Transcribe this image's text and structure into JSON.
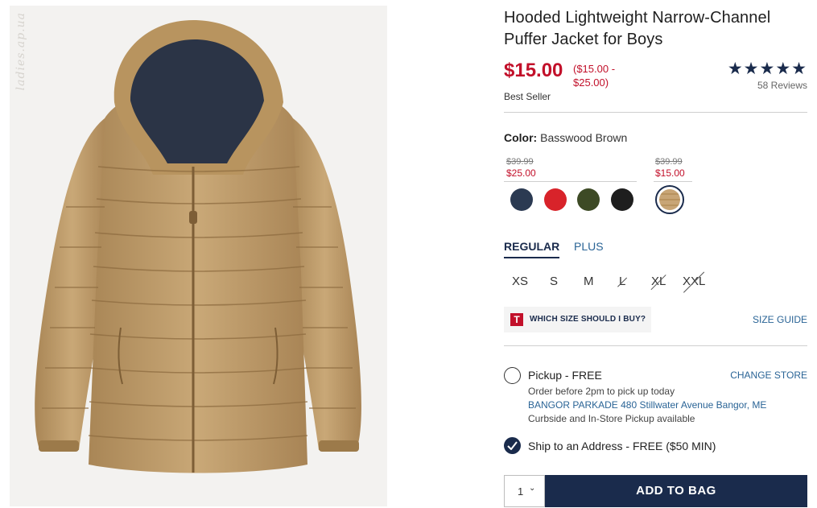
{
  "product": {
    "title": "Hooded Lightweight Narrow-Channel Puffer Jacket for Boys",
    "price": "$15.00",
    "price_range": "($15.00 - $25.00)",
    "badge": "Best Seller",
    "rating": {
      "stars": 4.5,
      "display": "★★★★★",
      "reviews_label": "58 Reviews"
    },
    "watermark": "ladies.ap.ua"
  },
  "color": {
    "label": "Color:",
    "selected": "Basswood Brown",
    "groups": [
      {
        "original": "$39.99",
        "sale": "$25.00"
      },
      {
        "original": "$39.99",
        "sale": "$15.00"
      }
    ],
    "swatches": [
      {
        "name": "navy",
        "color": "#2b3a52"
      },
      {
        "name": "red",
        "color": "#d8232a"
      },
      {
        "name": "olive",
        "color": "#3d4a25"
      },
      {
        "name": "black",
        "color": "#1e1e1e"
      },
      {
        "name": "Basswood Brown",
        "color": "#c8a576",
        "selected": true
      }
    ]
  },
  "fit_tabs": [
    {
      "label": "REGULAR",
      "active": true
    },
    {
      "label": "PLUS",
      "active": false
    }
  ],
  "sizes": [
    {
      "label": "XS",
      "available": true
    },
    {
      "label": "S",
      "available": true
    },
    {
      "label": "M",
      "available": true
    },
    {
      "label": "L",
      "available": false
    },
    {
      "label": "XL",
      "available": false
    },
    {
      "label": "XXL",
      "available": false
    }
  ],
  "size_help": {
    "badge": "T",
    "label": "WHICH SIZE SHOULD I BUY?",
    "guide_label": "SIZE GUIDE"
  },
  "fulfillment": {
    "pickup": {
      "label": "Pickup - FREE",
      "note": "Order before 2pm to pick up today",
      "store": "BANGOR PARKADE 480 Stillwater Avenue  Bangor, ME",
      "availability": "Curbside and In-Store Pickup available",
      "change_label": "CHANGE STORE",
      "selected": false
    },
    "ship": {
      "label": "Ship to an Address - FREE ($50 MIN)",
      "selected": true
    }
  },
  "cart": {
    "quantity": "1",
    "add_label": "ADD TO BAG"
  },
  "colors": {
    "brand_navy": "#1a2b4c",
    "sale_red": "#c2102a",
    "link_blue": "#2a6496"
  }
}
